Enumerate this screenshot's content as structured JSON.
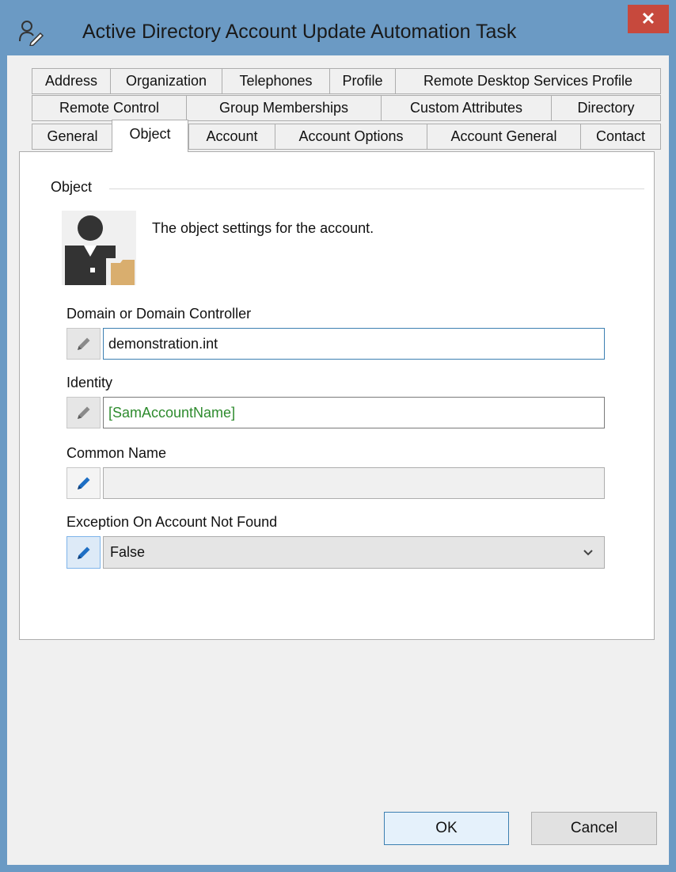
{
  "window": {
    "title": "Active Directory Account Update Automation Task",
    "close_label": "✕"
  },
  "tabs": {
    "row1": [
      {
        "label": "Address"
      },
      {
        "label": "Organization"
      },
      {
        "label": "Telephones"
      },
      {
        "label": "Profile"
      },
      {
        "label": "Remote Desktop Services Profile"
      }
    ],
    "row2": [
      {
        "label": "Remote Control"
      },
      {
        "label": "Group Memberships"
      },
      {
        "label": "Custom Attributes"
      },
      {
        "label": "Directory"
      }
    ],
    "row3": [
      {
        "label": "General"
      },
      {
        "label": "Object",
        "selected": true
      },
      {
        "label": "Account"
      },
      {
        "label": "Account Options"
      },
      {
        "label": "Account General"
      },
      {
        "label": "Contact"
      }
    ]
  },
  "object_group": {
    "label": "Object",
    "description": "The object settings for the account.",
    "icon": "user-folder-icon"
  },
  "fields": {
    "domain": {
      "label": "Domain or Domain Controller",
      "value": "demonstration.int"
    },
    "identity": {
      "label": "Identity",
      "value": "[SamAccountName]",
      "color": "#2e8b2e"
    },
    "common_name": {
      "label": "Common Name",
      "value": ""
    },
    "exception": {
      "label": "Exception On Account Not Found",
      "value": "False"
    }
  },
  "buttons": {
    "ok": "OK",
    "cancel": "Cancel"
  },
  "colors": {
    "frame": "#6b9ac4",
    "close": "#c7493d",
    "accent": "#3c7fb1"
  }
}
